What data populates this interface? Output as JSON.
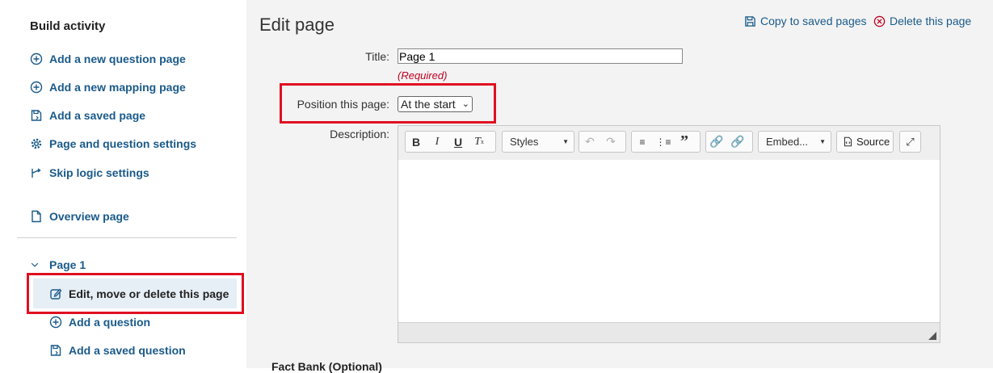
{
  "sidebar": {
    "title": "Build activity",
    "items": [
      {
        "label": "Add a new question page",
        "icon": "plus-circle-icon"
      },
      {
        "label": "Add a new mapping page",
        "icon": "plus-circle-icon"
      },
      {
        "label": "Add a saved page",
        "icon": "saved-page-icon"
      },
      {
        "label": "Page and question settings",
        "icon": "gear-icon"
      },
      {
        "label": "Skip logic settings",
        "icon": "skip-logic-icon"
      }
    ],
    "overview": {
      "label": "Overview page",
      "icon": "document-icon"
    },
    "page_group": {
      "label": "Page 1",
      "children": [
        {
          "label": "Edit, move or delete this page",
          "icon": "edit-icon",
          "active": true
        },
        {
          "label": "Add a question",
          "icon": "plus-circle-icon"
        },
        {
          "label": "Add a saved question",
          "icon": "saved-page-icon"
        }
      ]
    }
  },
  "main": {
    "title": "Edit page",
    "copy_link": "Copy to saved pages",
    "delete_link": "Delete this page",
    "form": {
      "title_label": "Title:",
      "title_value": "Page 1",
      "required_text": "(Required)",
      "position_label": "Position this page:",
      "position_value": "At the start",
      "description_label": "Description:"
    },
    "editor": {
      "styles_label": "Styles",
      "embed_label": "Embed...",
      "source_label": "Source"
    },
    "cutoff_text": "Fact Bank (Optional)"
  },
  "colors": {
    "highlight": "#e01020",
    "link": "#1a5a8a",
    "required": "#c00020"
  }
}
